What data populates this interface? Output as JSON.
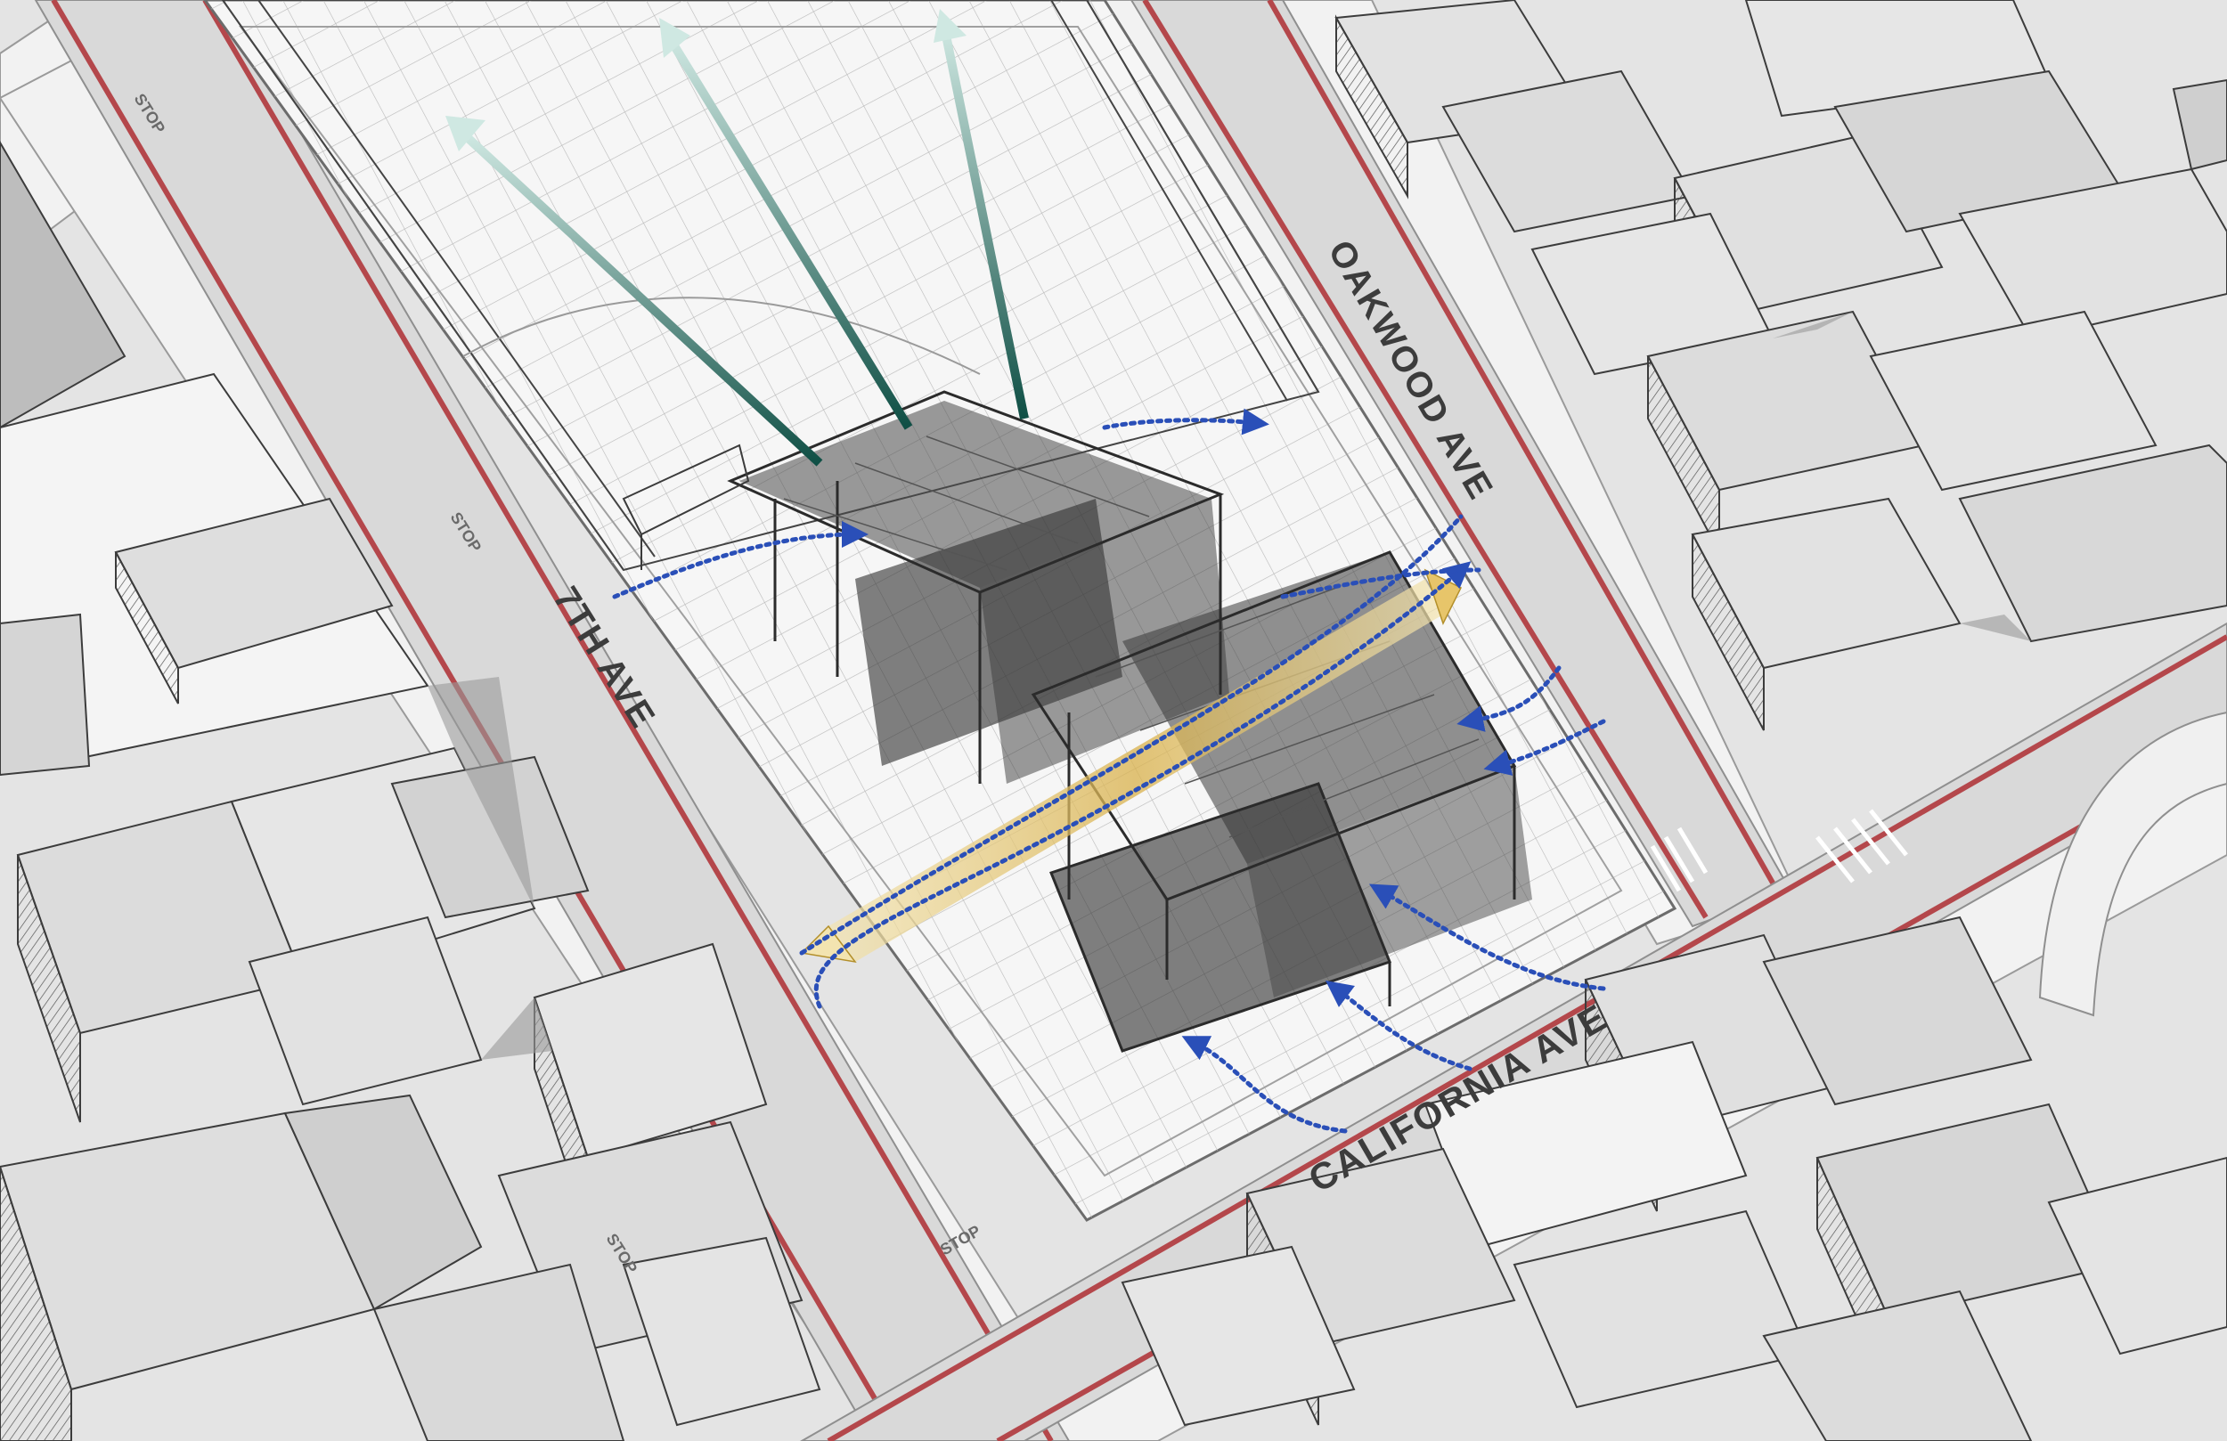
{
  "diagram": {
    "streets": {
      "seventh": "7TH AVE",
      "oakwood": "OAKWOOD AVE",
      "california": "CALIFORNIA AVE"
    },
    "road_markings": [
      "STOP",
      "STOP",
      "STOP",
      "STOP"
    ],
    "colors": {
      "road": "#d9d9d9",
      "sidewalk": "#f1f1f1",
      "curb_red": "#b4474b",
      "building": "#dcdcdc",
      "building_roof": "#e6e6e6",
      "building_shadow": "#8c8c8c",
      "site_grid": "#bdbdbd",
      "structure": "#3b3b3b",
      "airflow_blue": "#2a4fb8",
      "sun_yellow": "#e7c56a",
      "view_green": "#2f7a6e"
    }
  }
}
